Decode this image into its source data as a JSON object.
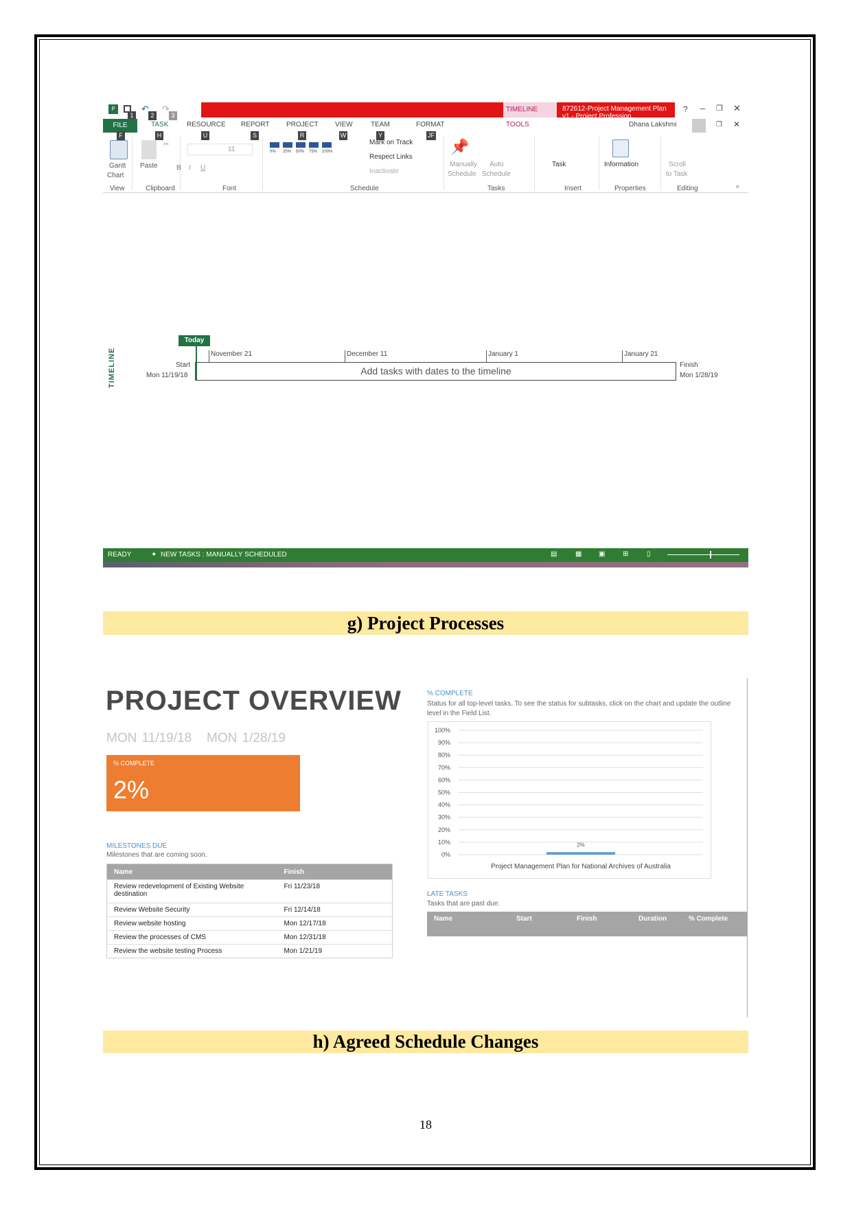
{
  "ribbon": {
    "qat_keys": [
      "1",
      "2",
      "3"
    ],
    "contextual_tab": "TIMELINE TOOLS",
    "window_title": "872612-Project Management Plan v1 - Project Profession...",
    "help": "?",
    "user": "Dhana Lakshmi",
    "tabs": [
      {
        "label": "FILE",
        "key": "F"
      },
      {
        "label": "TASK",
        "key": "H"
      },
      {
        "label": "RESOURCE",
        "key": "U"
      },
      {
        "label": "REPORT",
        "key": "S"
      },
      {
        "label": "PROJECT",
        "key": "R"
      },
      {
        "label": "VIEW",
        "key": "W"
      },
      {
        "label": "TEAM",
        "key": "Y"
      },
      {
        "label": "FORMAT",
        "key": "JF"
      }
    ],
    "gantt_label": "Gantt",
    "gantt_label2": "Chart",
    "paste": "Paste",
    "font_size": "11",
    "font_btns": [
      "B",
      "I",
      "U"
    ],
    "pct_btns": [
      "0%",
      "25%",
      "50%",
      "75%",
      "100%"
    ],
    "mark_on_track": "Mark on Track",
    "respect_links": "Respect Links",
    "inactivate": "Inactivate",
    "manually": "Manually",
    "manually2": "Schedule",
    "auto": "Auto",
    "auto2": "Schedule",
    "task": "Task",
    "information": "Information",
    "scroll": "Scroll",
    "scroll2": "to Task",
    "groups": [
      "View",
      "Clipboard",
      "Font",
      "Schedule",
      "Tasks",
      "Insert",
      "Properties",
      "Editing"
    ]
  },
  "timeline": {
    "label": "TIMELINE",
    "today": "Today",
    "ticks": [
      "November 21",
      "December 11",
      "January 1",
      "January 21"
    ],
    "start_label": "Start",
    "start_date": "Mon 11/19/18",
    "finish_label": "Finish",
    "finish_date": "Mon 1/28/19",
    "placeholder": "Add tasks with dates to the timeline"
  },
  "statusbar": {
    "ready": "READY",
    "new_tasks": "NEW TASKS : MANUALLY SCHEDULED"
  },
  "headings": {
    "g": "g)  Project Processes",
    "h": "h)  Agreed Schedule Changes"
  },
  "overview": {
    "title": "PROJECT OVERVIEW",
    "start": "MON 11/19/18",
    "finish": "MON 1/28/19",
    "complete_label": "% COMPLETE",
    "complete_value": "2%",
    "milestones_title": "MILESTONES DUE",
    "milestones_sub": "Milestones that are coming soon.",
    "milestones_cols": [
      "Name",
      "Finish"
    ],
    "milestones": [
      [
        "Review redevelopment of Existing Website destination",
        "Fri 11/23/18"
      ],
      [
        "Review Website Security",
        "Fri 12/14/18"
      ],
      [
        "Review website hosting",
        "Mon 12/17/18"
      ],
      [
        "Review the processes of CMS",
        "Mon 12/31/18"
      ],
      [
        "Review the website testing Process",
        "Mon 1/21/19"
      ]
    ],
    "chart_title": "% COMPLETE",
    "chart_sub": "Status for all top-level tasks. To see the status for subtasks, click on the chart and update the outline level in the Field List.",
    "late_title": "LATE TASKS",
    "late_sub": "Tasks that are past due.",
    "late_cols": [
      "Name",
      "Start",
      "Finish",
      "Duration",
      "% Complete"
    ]
  },
  "chart_data": {
    "type": "bar",
    "categories": [
      "Project Management Plan for National Archives of Australia"
    ],
    "values": [
      2
    ],
    "data_labels": [
      "2%"
    ],
    "yticks": [
      "100%",
      "90%",
      "80%",
      "70%",
      "60%",
      "50%",
      "40%",
      "30%",
      "20%",
      "10%",
      "0%"
    ],
    "ylim": [
      0,
      100
    ],
    "grid": true,
    "color": "#5b9bd5"
  },
  "page_number": "18"
}
